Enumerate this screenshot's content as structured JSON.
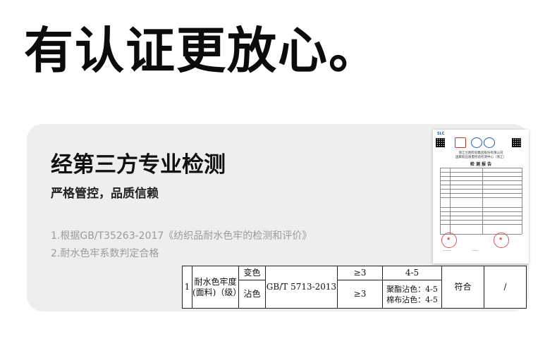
{
  "headline": "有认证更放心。",
  "card": {
    "title": "经第三方专业检测",
    "subtitle": "严格管控，品质信赖",
    "notes": [
      "1.根据GB/T35263-2017《纺织品耐水色牢的检测和评价》",
      "2.耐水色牢系数判定合格"
    ]
  },
  "report": {
    "logo_text": "SLC",
    "header_line1": "浙江兰图检验集团股份有限公司",
    "header_line2": "国家纺丝质量检验检测中心（浙江）",
    "title": "检 测 报 告"
  },
  "table": {
    "index": "1",
    "item": "耐水色牢度(面料)（级）",
    "rows": [
      {
        "sub": "变色",
        "req": "≥3",
        "result": "4-5"
      },
      {
        "sub": "沾色",
        "req": "≥3",
        "result": "聚酯沾色：4-5 棉布沾色：4-5"
      }
    ],
    "method": "GB/T 5713-2013",
    "verdict": "符合",
    "remark": "/"
  }
}
